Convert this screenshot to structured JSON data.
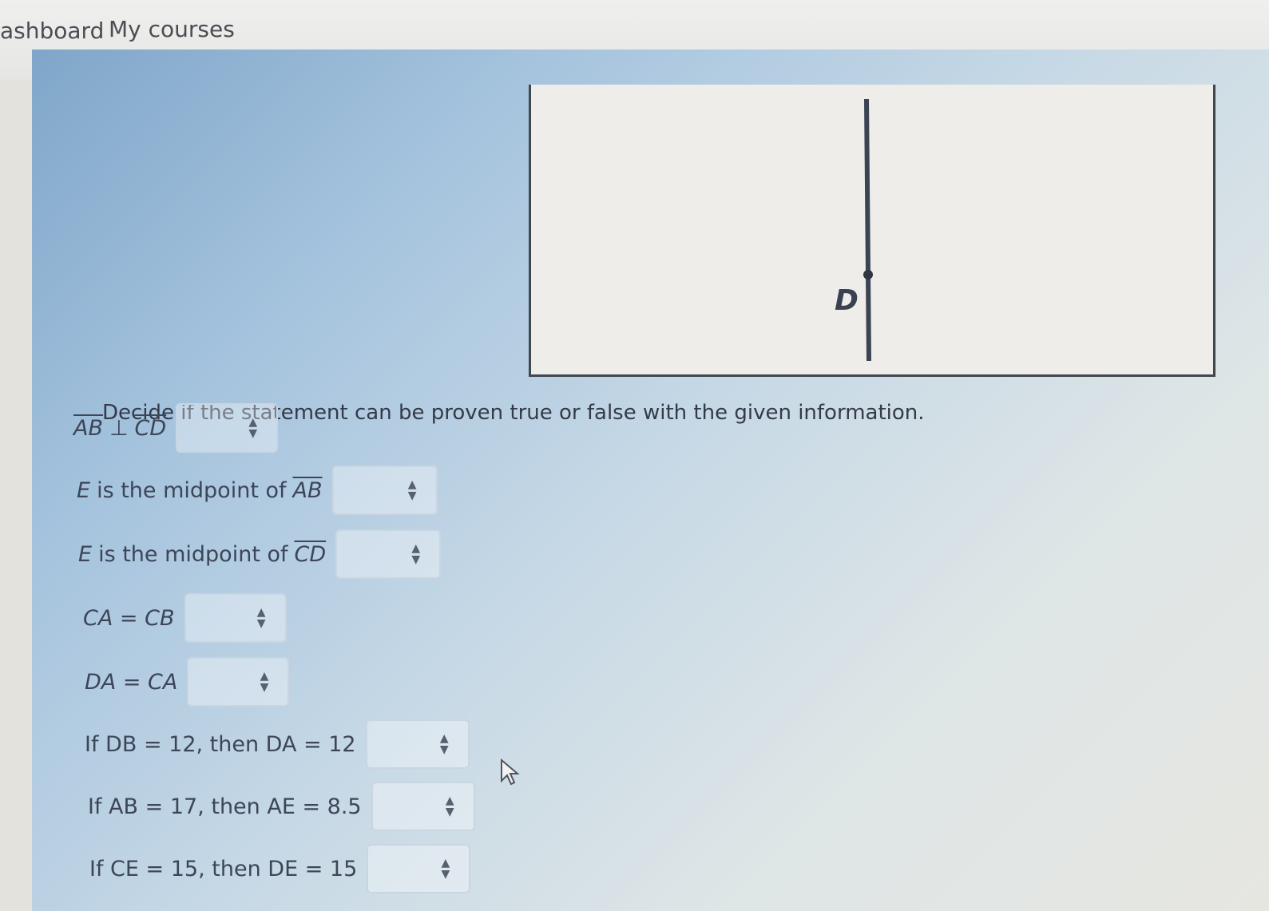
{
  "nav": {
    "dashboard_label": "ashboard",
    "courses_label": "My courses"
  },
  "diagram": {
    "point_label": "D"
  },
  "question": {
    "prompt": "Decide if the statement can be proven true or false with the given information."
  },
  "statements": [
    {
      "parts": [
        "AB",
        "⊥",
        "CD"
      ],
      "selected": ""
    },
    {
      "text": "is the midpoint of",
      "lead": "E",
      "seg": "AB",
      "selected": ""
    },
    {
      "text": "is the midpoint of",
      "lead": "E",
      "seg": "CD",
      "selected": ""
    },
    {
      "text": "CA = CB",
      "selected": ""
    },
    {
      "text": "DA = CA",
      "selected": ""
    },
    {
      "text": "If DB = 12, then DA = 12",
      "selected": ""
    },
    {
      "text": "If AB = 17, then AE = 8.5",
      "selected": ""
    },
    {
      "text": "If CE = 15, then DE = 15",
      "selected": ""
    }
  ],
  "icons": {
    "select_arrow": "updown-arrow-icon",
    "cursor": "mouse-pointer-icon"
  }
}
